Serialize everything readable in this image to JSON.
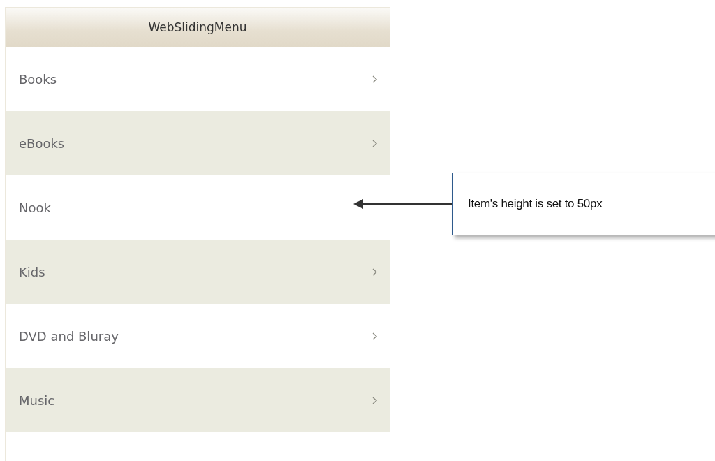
{
  "menu": {
    "title": "WebSlidingMenu",
    "items": [
      {
        "label": "Books",
        "has_submenu": true
      },
      {
        "label": "eBooks",
        "has_submenu": true
      },
      {
        "label": "Nook",
        "has_submenu": false
      },
      {
        "label": "Kids",
        "has_submenu": true
      },
      {
        "label": "DVD and Bluray",
        "has_submenu": true
      },
      {
        "label": "Music",
        "has_submenu": true
      }
    ]
  },
  "callout": {
    "text": "Item's height is set to 50px"
  }
}
